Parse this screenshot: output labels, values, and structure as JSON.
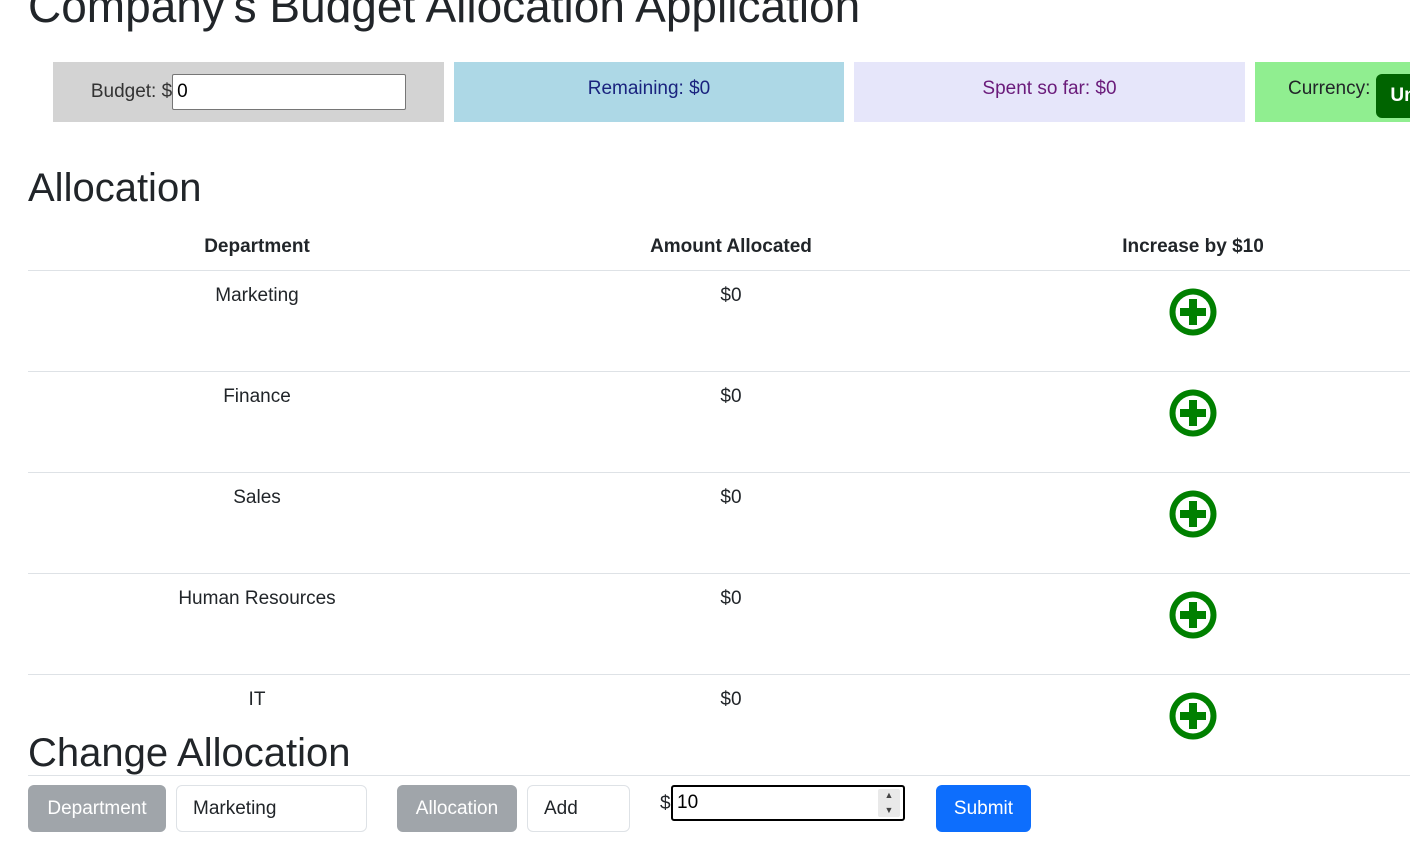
{
  "app": {
    "title": "Company's Budget Allocation Application"
  },
  "summary": {
    "budget_label": "Budget: $",
    "budget_value": "0",
    "remaining_text": "Remaining: $0",
    "spent_text": "Spent so far: $0",
    "currency_label": "Currency:",
    "currency_value": "Uni"
  },
  "allocation": {
    "heading": "Allocation",
    "columns": [
      "Department",
      "Amount Allocated",
      "Increase by $10"
    ],
    "rows": [
      {
        "department": "Marketing",
        "amount": "$0",
        "action_icon": "plus-circle-icon"
      },
      {
        "department": "Finance",
        "amount": "$0",
        "action_icon": "plus-circle-icon"
      },
      {
        "department": "Sales",
        "amount": "$0",
        "action_icon": "plus-circle-icon"
      },
      {
        "department": "Human Resources",
        "amount": "$0",
        "action_icon": "plus-circle-icon"
      },
      {
        "department": "IT",
        "amount": "$0",
        "action_icon": "plus-circle-icon"
      }
    ]
  },
  "change": {
    "heading": "Change Allocation",
    "department_label": "Department",
    "department_value": "Marketing",
    "allocation_label": "Allocation",
    "allocation_type": "Add",
    "currency_sign": "$",
    "amount_value": "10",
    "submit_label": "Submit"
  },
  "colors": {
    "budget_bg": "#d3d3d3",
    "remaining_bg": "#add8e6",
    "spent_bg": "#e6e6fa",
    "currency_bg": "#90ee90",
    "currency_select_bg": "#006400",
    "plus_icon": "#008000",
    "submit_bg": "#0d6efd",
    "label_chip_bg": "#a0a5aa"
  }
}
